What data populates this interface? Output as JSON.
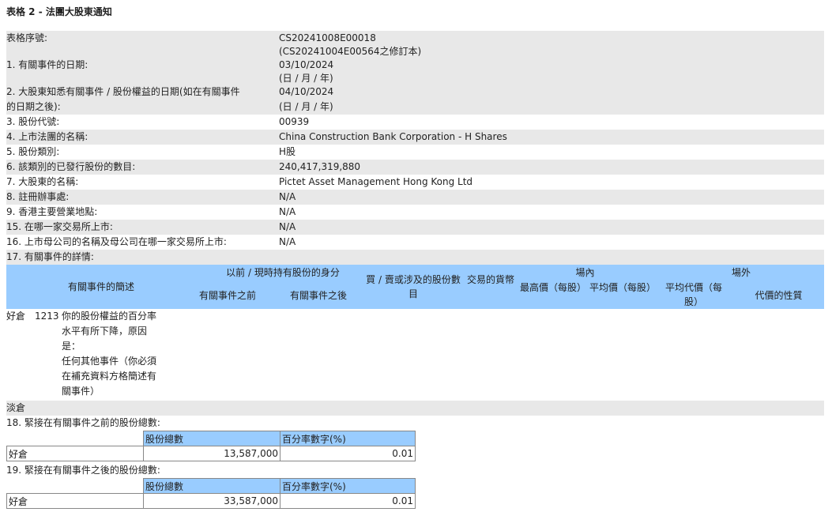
{
  "title": "表格 2 - 法團大股東通知",
  "fields": [
    {
      "label": "表格序號:",
      "value": "CS20241008E00018",
      "value2": "(CS20241004E00564之修訂本)"
    },
    {
      "label": "1. 有關事件的日期:",
      "value": "03/10/2024",
      "value2": "(日 / 月 / 年)"
    },
    {
      "label": "2. 大股東知悉有關事件 / 股份權益的日期(如在有關事件",
      "label2": "的日期之後):",
      "value": "04/10/2024",
      "value2": "(日 / 月 / 年)"
    },
    {
      "label": "3. 股份代號:",
      "value": "00939"
    },
    {
      "label": "4. 上市法團的名稱:",
      "value": "China Construction Bank Corporation - H Shares"
    },
    {
      "label": "5. 股份類別:",
      "value": "H股"
    },
    {
      "label": "6. 該類別的已發行股份的數目:",
      "value": "240,417,319,880"
    },
    {
      "label": "7. 大股東的名稱:",
      "value": "Pictet Asset Management Hong Kong Ltd"
    },
    {
      "label": "8. 註冊辦事處:",
      "value": "N/A"
    },
    {
      "label": "9. 香港主要營業地點:",
      "value": "N/A"
    },
    {
      "label": "15. 在哪一家交易所上市:",
      "value": "N/A"
    },
    {
      "label": "16. 上市母公司的名稱及母公司在哪一家交易所上市:",
      "value": "N/A"
    },
    {
      "label": "17. 有關事件的詳情:"
    }
  ],
  "event_header": {
    "description": "有關事件的簡述",
    "capacity": "以前 / 現時持有股份的身分",
    "before": "有關事件之前",
    "after": "有關事件之後",
    "shares": "買 / 賣或涉及的股份數目",
    "currency": "交易的貨幣",
    "onexch": "場內",
    "highest": "最高價（每股）",
    "avg": "平均價（每股）",
    "offexch": "場外",
    "avgcons": "平均代價（每股）",
    "nature": "代價的性質"
  },
  "event_row": {
    "position": "好倉",
    "code": "1213",
    "desc_lines": [
      "你的股份權益的百分率",
      "水平有所下降，原因",
      "是：",
      "任何其他事件（你必須",
      "在補充資料方格簡述有",
      "關事件）"
    ]
  },
  "short_label": "淡倉",
  "sec18": {
    "label": "18. 緊接在有關事件之前的股份總數:",
    "col1": "股份總數",
    "col2": "百分率數字(%)",
    "row_label": "好倉",
    "shares": "13,587,000",
    "pct": "0.01"
  },
  "sec19": {
    "label": "19. 緊接在有關事件之後的股份總數:",
    "col1": "股份總數",
    "col2": "百分率數字(%)",
    "row_label": "好倉",
    "shares": "33,587,000",
    "pct": "0.01"
  }
}
